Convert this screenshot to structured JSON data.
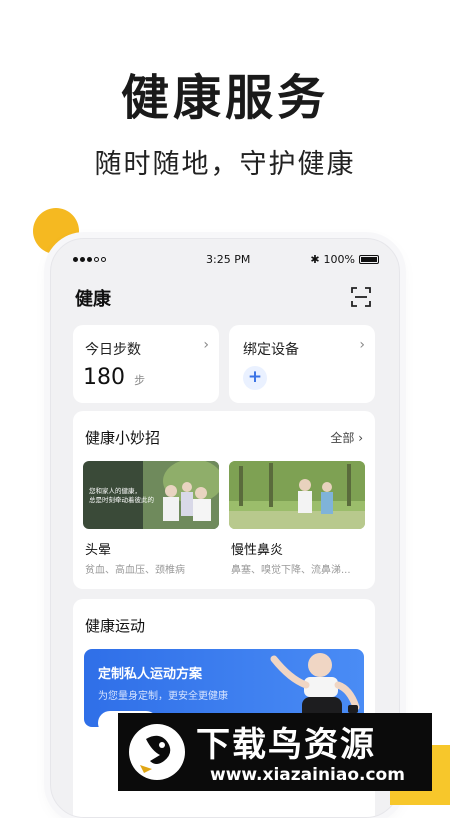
{
  "promo": {
    "headline": "健康服务",
    "subline": "随时随地，守护健康"
  },
  "status_bar": {
    "time": "3:25 PM",
    "battery": "100%"
  },
  "app": {
    "title": "健康"
  },
  "steps_card": {
    "title": "今日步数",
    "value": "180",
    "unit": "步"
  },
  "device_card": {
    "title": "绑定设备",
    "add_label": "+"
  },
  "tips": {
    "title": "健康小妙招",
    "all_label": "全部",
    "items": [
      {
        "name": "头晕",
        "desc": "贫血、高血压、颈椎病",
        "image_caption_1": "您和家人的健康，",
        "image_caption_2": "总是时刻牵动着彼此的"
      },
      {
        "name": "慢性鼻炎",
        "desc": "鼻塞、嗅觉下降、流鼻涕..."
      }
    ]
  },
  "exercise": {
    "title": "健康运动",
    "banner_title": "定制私人运动方案",
    "banner_sub": "为您量身定制，更安全更健康"
  },
  "watermark": {
    "title": "下载鸟资源",
    "url": "www.xiazainiao.com"
  },
  "colors": {
    "accent_yellow": "#f5b921",
    "accent_blue": "#2f6fe8"
  }
}
